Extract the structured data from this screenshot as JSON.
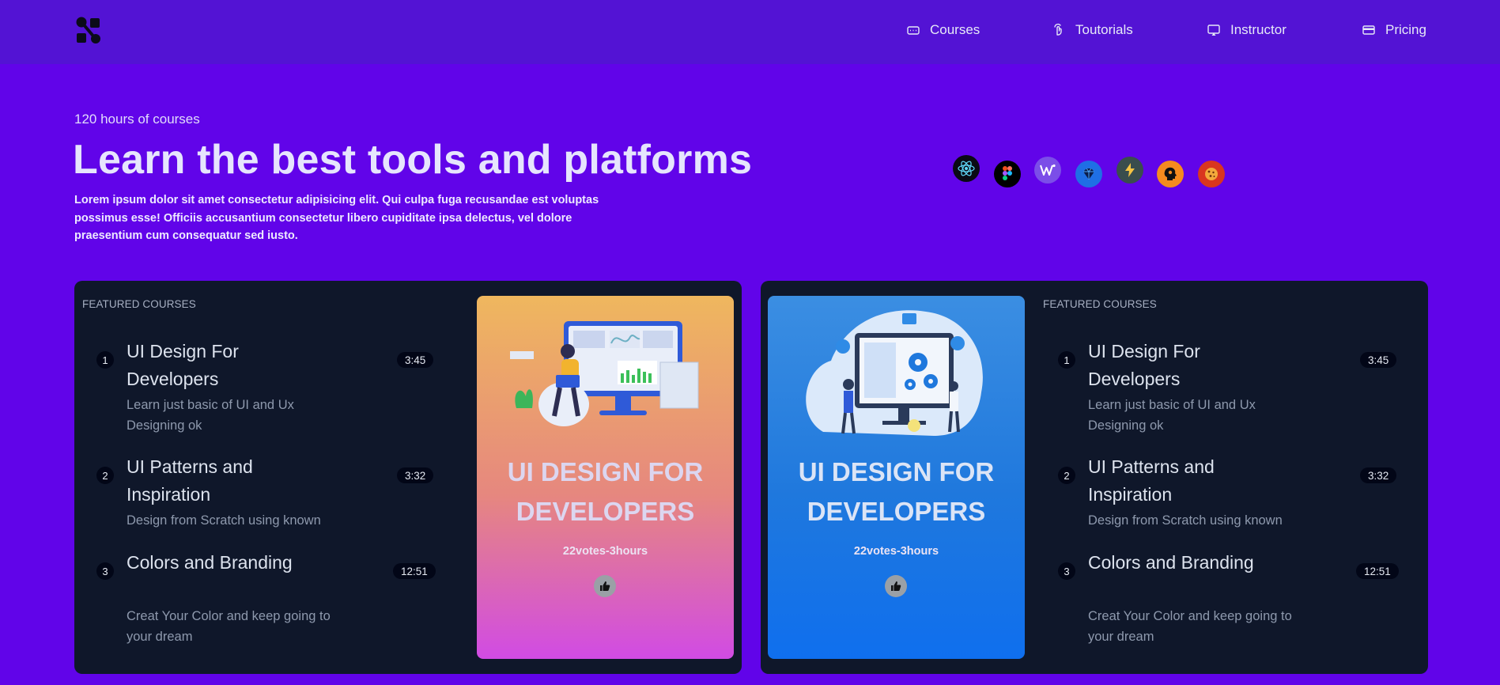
{
  "nav": {
    "items": [
      {
        "label": "Courses",
        "icon": "keyboard-icon"
      },
      {
        "label": "Toutorials",
        "icon": "hand-pointer-icon"
      },
      {
        "label": "Instructor",
        "icon": "monitor-icon"
      },
      {
        "label": "Pricing",
        "icon": "credit-card-icon"
      }
    ]
  },
  "hero": {
    "eyebrow": "120 hours of courses",
    "title": "Learn the best tools and platforms",
    "description": "Lorem ipsum dolor sit amet consectetur adipisicing elit. Qui culpa fuga recusandae est voluptas possimus esse! Officiis accusantium consectetur libero cupiditate ipsa delectus, vel dolore praesentium cum consequatur sed iusto.",
    "tools": [
      "react-icon",
      "figma-icon",
      "webflow-icon",
      "gem-icon",
      "bolt-icon",
      "brain-icon",
      "cookie-icon"
    ]
  },
  "panels": [
    {
      "feature_label": "FEATURED COURSES",
      "courses": [
        {
          "num": "1",
          "title": "UI Design For Developers",
          "subtitle": "Learn just basic of UI and Ux Designing ok",
          "duration": "3:45"
        },
        {
          "num": "2",
          "title": "UI Patterns and Inspiration",
          "subtitle": "Design from Scratch using known",
          "duration": "3:32"
        },
        {
          "num": "3",
          "title": "Colors and Branding",
          "subtitle": "Creat Your Color and keep going to your dream",
          "duration": "12:51"
        }
      ],
      "card": {
        "title": "UI DESIGN FOR DEVELOPERS",
        "meta": "22votes-3hours"
      }
    },
    {
      "feature_label": "FEATURED COURSES",
      "courses": [
        {
          "num": "1",
          "title": "UI Design For Developers",
          "subtitle": "Learn just basic of UI and Ux Designing ok",
          "duration": "3:45"
        },
        {
          "num": "2",
          "title": "UI Patterns and Inspiration",
          "subtitle": "Design from Scratch using known",
          "duration": "3:32"
        },
        {
          "num": "3",
          "title": "Colors and Branding",
          "subtitle": "Creat Your Color and keep going to your dream",
          "duration": "12:51"
        }
      ],
      "card": {
        "title": "UI DESIGN FOR DEVELOPERS",
        "meta": "22votes-3hours"
      }
    }
  ],
  "colors": {
    "page_bg": "#6104e9",
    "nav_bg": "#5313d4",
    "panel_bg": "#0f172a",
    "card_orange_top": "#efb75e",
    "card_orange_bottom": "#d14be4",
    "card_blue": "#1f78dd"
  }
}
